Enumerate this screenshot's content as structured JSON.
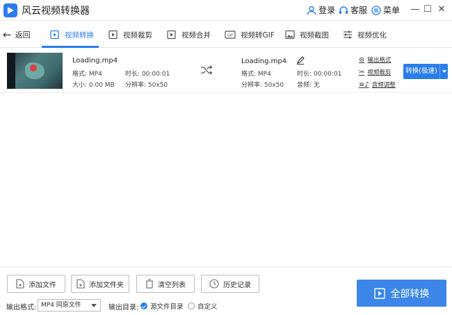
{
  "app": {
    "title": "风云视频转换器"
  },
  "titlebar": {
    "login": "登录",
    "service": "客服",
    "menu": "菜单"
  },
  "nav": {
    "back": "返回",
    "tabs": [
      "视频转换",
      "视频裁剪",
      "视频合并",
      "视频转GIF",
      "视频截图",
      "视频优化"
    ]
  },
  "file": {
    "source": {
      "name": "Loading.mp4",
      "format": "格式: MP4",
      "duration": "时长: 00:00:01",
      "size": "大小: 0.00 MB",
      "resolution": "分辨率: 50x50"
    },
    "output": {
      "name": "Loading.mp4",
      "format": "格式: MP4",
      "duration": "时长: 00:00:01",
      "resolution": "分辨率: 50x50",
      "audio": "音频: 无"
    },
    "actions": {
      "output_format": "输出格式",
      "video_crop": "视频裁剪",
      "audio_adjust": "音频调整"
    },
    "convert_label": "转换(极速)"
  },
  "bottom": {
    "add_file": "添加文件",
    "add_folder": "添加文件夹",
    "clear_list": "清空列表",
    "history": "历史记录",
    "output_format_label": "输出格式:",
    "output_format_value": "MP4 同原文件",
    "output_dir_label": "输出目录:",
    "dir_source": "源文件目录",
    "dir_custom": "自定义",
    "convert_all": "全部转换"
  },
  "colors": {
    "accent": "#2b7de9"
  }
}
